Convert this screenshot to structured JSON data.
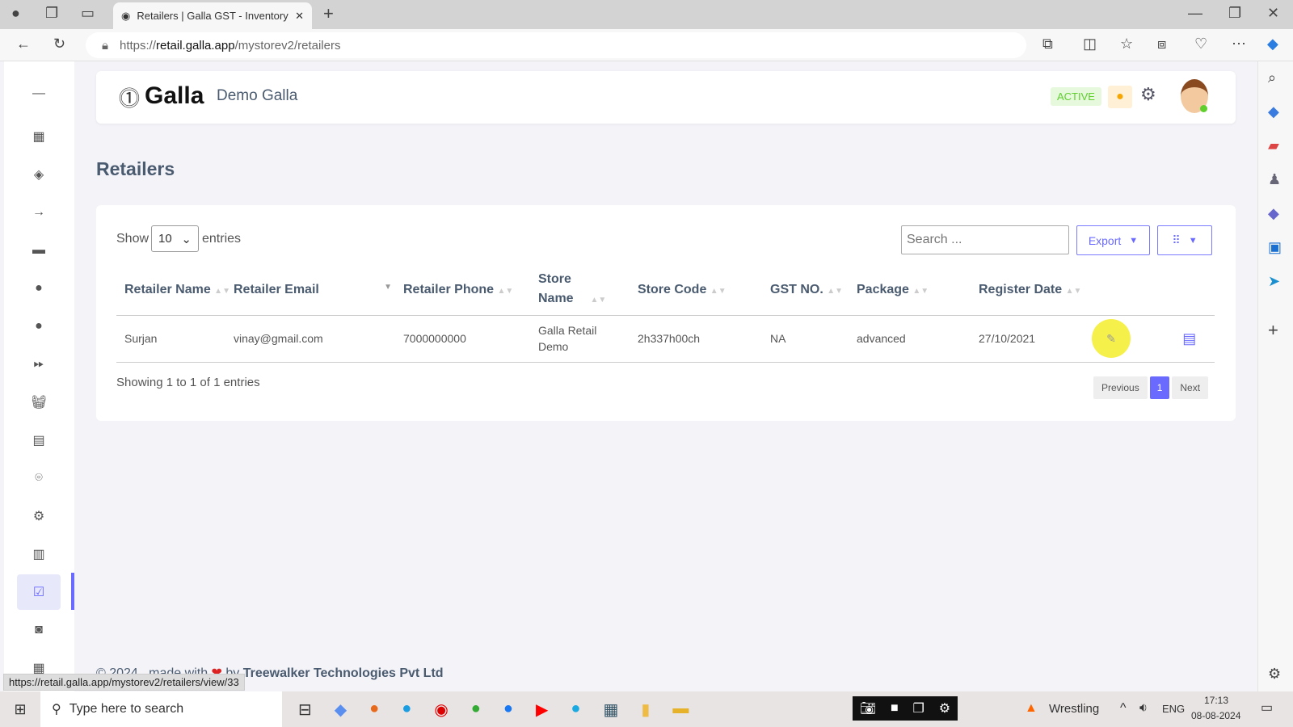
{
  "browser": {
    "tab_title": "Retailers | Galla GST - Inventory S",
    "url_prefix": "https://",
    "url_domain": "retail.galla.app",
    "url_path": "/mystorev2/retailers",
    "status_url": "https://retail.galla.app/mystorev2/retailers/view/33"
  },
  "header": {
    "brand": "Galla",
    "store": "Demo Galla",
    "status": "ACTIVE"
  },
  "page": {
    "title": "Retailers"
  },
  "table_controls": {
    "show": "Show",
    "entries": "entries",
    "page_size": "10",
    "search_placeholder": "Search ...",
    "export": "Export"
  },
  "columns": [
    "Retailer Name",
    "Retailer Email",
    "Retailer Phone",
    "Store Name",
    "Store Code",
    "GST NO.",
    "Package",
    "Register Date"
  ],
  "rows": [
    {
      "name": "Surjan",
      "email": "vinay@gmail.com",
      "phone": "7000000000",
      "store": "Galla Retail Demo",
      "code": "2h337h00ch",
      "gst": "NA",
      "package": "advanced",
      "date": "27/10/2021"
    }
  ],
  "pagination": {
    "info": "Showing 1 to 1 of 1 entries",
    "previous": "Previous",
    "current": "1",
    "next": "Next"
  },
  "footer": {
    "prefix": "© 2024 , made with",
    "by": "by",
    "company": "Treewalker Technologies Pvt Ltd"
  },
  "taskbar": {
    "search": "Type here to search",
    "weather": "Wrestling",
    "lang": "ENG",
    "time": "17:13",
    "date": "08-08-2024"
  },
  "colors": {
    "accent": "#6a6aff",
    "active_bg": "#e6f9dc",
    "active_text": "#5fcf2e"
  }
}
